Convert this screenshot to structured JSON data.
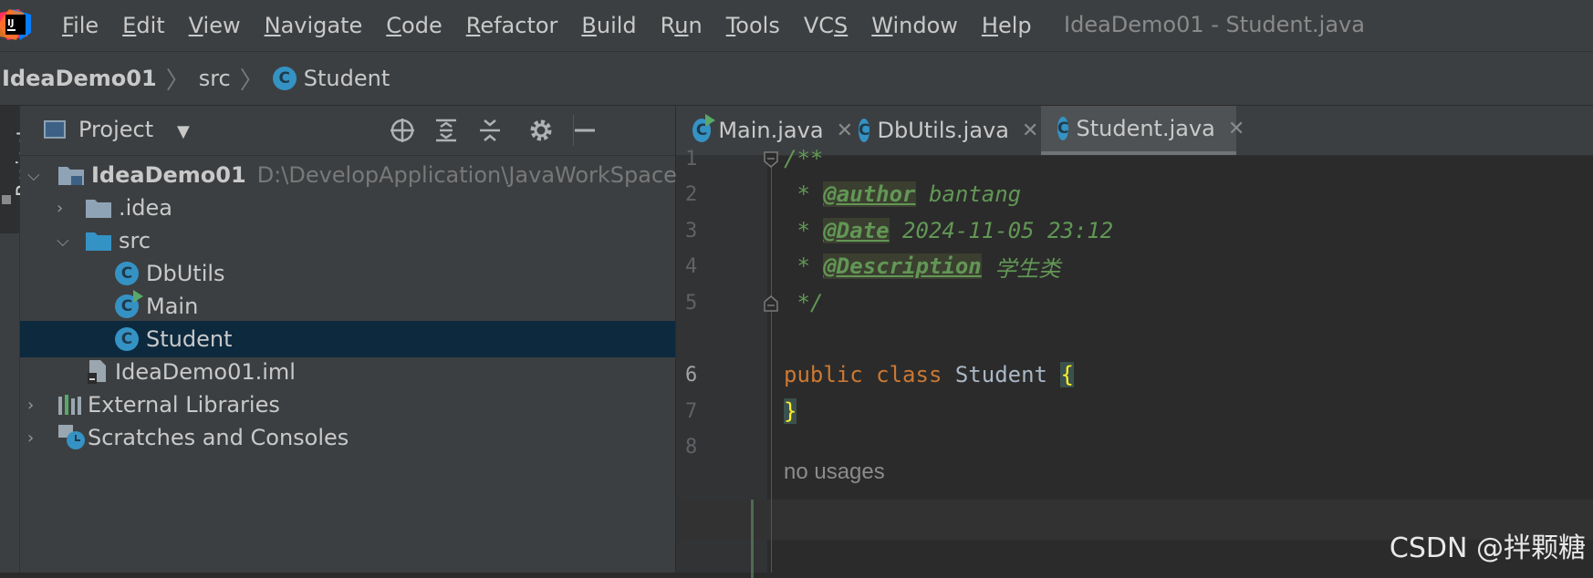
{
  "app": {
    "logo_text": "IJ",
    "window_title": "IdeaDemo01 - Student.java"
  },
  "menu": [
    {
      "pre": "",
      "ul": "F",
      "post": "ile"
    },
    {
      "pre": "",
      "ul": "E",
      "post": "dit"
    },
    {
      "pre": "",
      "ul": "V",
      "post": "iew"
    },
    {
      "pre": "",
      "ul": "N",
      "post": "avigate"
    },
    {
      "pre": "",
      "ul": "C",
      "post": "ode"
    },
    {
      "pre": "",
      "ul": "R",
      "post": "efactor"
    },
    {
      "pre": "",
      "ul": "B",
      "post": "uild"
    },
    {
      "pre": "R",
      "ul": "u",
      "post": "n"
    },
    {
      "pre": "",
      "ul": "T",
      "post": "ools"
    },
    {
      "pre": "VC",
      "ul": "S",
      "post": ""
    },
    {
      "pre": "",
      "ul": "W",
      "post": "indow"
    },
    {
      "pre": "",
      "ul": "H",
      "post": "elp"
    }
  ],
  "breadcrumb": {
    "project": "IdeaDemo01",
    "folder": "src",
    "file": "Student"
  },
  "tool_stripe": {
    "project_label": "Project"
  },
  "project_panel": {
    "title": "Project",
    "tree": {
      "root": {
        "name": "IdeaDemo01",
        "path": "D:\\DevelopApplication\\JavaWorkSpace\\Id"
      },
      "idea": ".idea",
      "src": "src",
      "dbutils": "DbUtils",
      "main": "Main",
      "student": "Student",
      "iml": "IdeaDemo01.iml",
      "external_libraries": "External Libraries",
      "scratches": "Scratches and Consoles"
    }
  },
  "tabs": [
    {
      "label": "Main.java",
      "icon": "java-class-runnable-icon",
      "active": false
    },
    {
      "label": "DbUtils.java",
      "icon": "java-class-icon",
      "active": false
    },
    {
      "label": "Student.java",
      "icon": "java-class-icon",
      "active": true
    }
  ],
  "editor": {
    "line_numbers": [
      "1",
      "2",
      "3",
      "4",
      "5",
      "6",
      "7",
      "8"
    ],
    "inlay_hint": "no usages",
    "code": {
      "l1": "/**",
      "l2_prefix": " * ",
      "l2_tag": "@author",
      "l2_text": " bantang",
      "l3_prefix": " * ",
      "l3_tag": "@Date",
      "l3_text": " 2024-11-05 23:12",
      "l4_prefix": " * ",
      "l4_tag": "@Description",
      "l4_text": " 学生类",
      "l5": " */",
      "l6_kw1": "public",
      "l6_kw2": "class",
      "l6_name": "Student",
      "l6_brace": "{",
      "l7_brace": "}"
    }
  },
  "watermark": "CSDN @拌颗糖",
  "colors": {
    "accent_blue": "#3592c4",
    "selection": "#0d293e",
    "doc_green": "#629755",
    "keyword_orange": "#cc7832"
  }
}
